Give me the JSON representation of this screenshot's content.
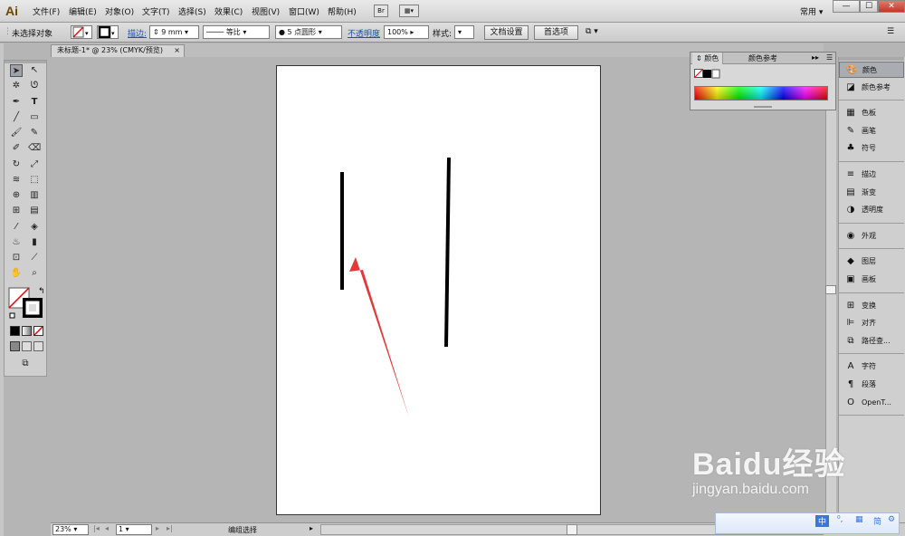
{
  "app": {
    "logo": "Ai"
  },
  "menubar": {
    "items": [
      "文件(F)",
      "编辑(E)",
      "对象(O)",
      "文字(T)",
      "选择(S)",
      "效果(C)",
      "视图(V)",
      "窗口(W)",
      "帮助(H)"
    ],
    "bridge_label": "Br",
    "workspace": "常用",
    "window_min": "—",
    "window_max": "☐",
    "window_close": "✕"
  },
  "controlbar": {
    "selection_status": "未选择对象",
    "stroke_label": "描边:",
    "stroke_weight": "9 mm",
    "stroke_profile": "等比",
    "brush": "5 点圆形",
    "opacity_label": "不透明度",
    "opacity_value": "100%",
    "style_label": "样式:",
    "doc_setup_button": "文档设置",
    "preferences_button": "首选项"
  },
  "document_tab": {
    "title": "未标题-1* @ 23% (CMYK/预览)",
    "close": "×"
  },
  "color_panel": {
    "tabs": [
      "颜色",
      "颜色参考"
    ],
    "spectrum_colors": [
      "#ff0000",
      "#ffff00",
      "#00ff00",
      "#00ffff",
      "#0000ff",
      "#ff00ff",
      "#ff0000"
    ]
  },
  "dock": {
    "groups": [
      [
        {
          "label": "颜色",
          "icon": "palette-icon"
        },
        {
          "label": "颜色参考",
          "icon": "color-guide-icon"
        }
      ],
      [
        {
          "label": "色板",
          "icon": "swatches-icon"
        },
        {
          "label": "画笔",
          "icon": "brush-icon"
        },
        {
          "label": "符号",
          "icon": "symbol-icon"
        }
      ],
      [
        {
          "label": "描边",
          "icon": "stroke-icon"
        },
        {
          "label": "渐变",
          "icon": "gradient-icon"
        },
        {
          "label": "透明度",
          "icon": "transparency-icon"
        }
      ],
      [
        {
          "label": "外观",
          "icon": "appearance-icon"
        }
      ],
      [
        {
          "label": "图层",
          "icon": "layers-icon"
        },
        {
          "label": "画板",
          "icon": "artboards-icon"
        }
      ],
      [
        {
          "label": "变换",
          "icon": "transform-icon"
        },
        {
          "label": "对齐",
          "icon": "align-icon"
        },
        {
          "label": "路径查...",
          "icon": "pathfinder-icon"
        }
      ],
      [
        {
          "label": "字符",
          "icon": "character-icon"
        },
        {
          "label": "段落",
          "icon": "paragraph-icon"
        },
        {
          "label": "OpenT...",
          "icon": "opentype-icon"
        }
      ]
    ]
  },
  "statusbar": {
    "zoom": "23%",
    "artboard_number": "1",
    "status_text": "编组选择"
  },
  "watermark": {
    "brand": "Baidu经验",
    "url": "jingyan.baidu.com"
  },
  "ime": {
    "mode": "中",
    "simplified": "简"
  }
}
